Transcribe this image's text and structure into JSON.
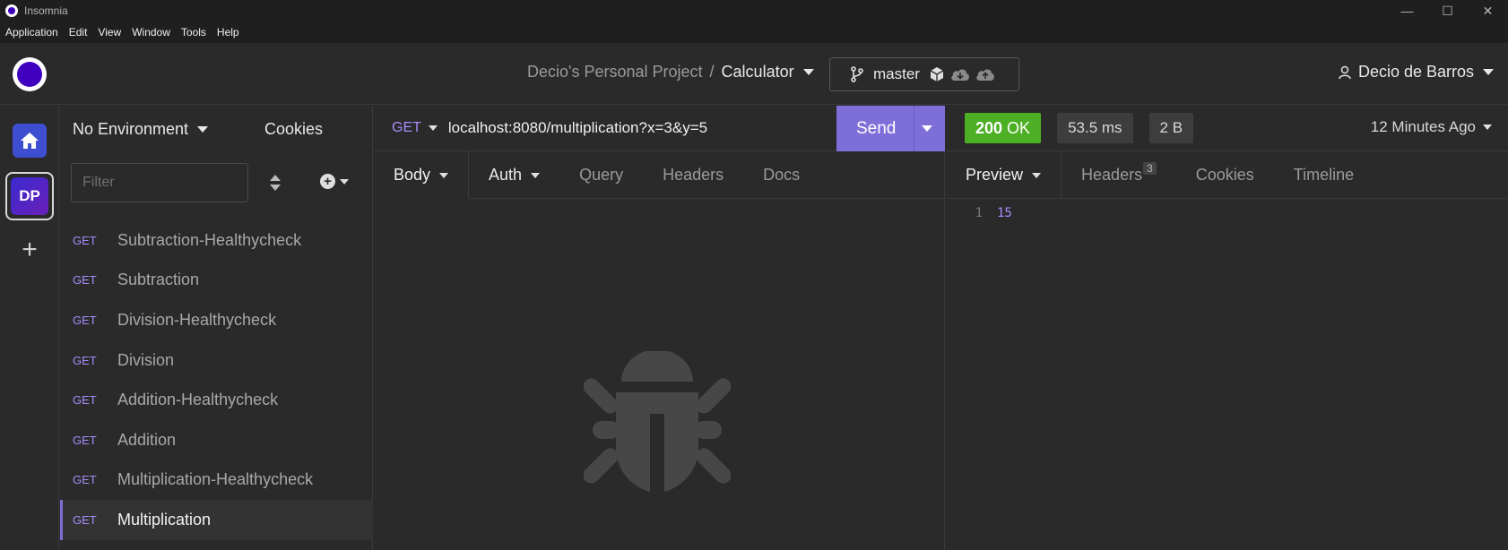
{
  "window": {
    "title": "Insomnia",
    "controls": {
      "minimize": "—",
      "maximize": "☐",
      "close": "✕"
    }
  },
  "menu": [
    "Application",
    "Edit",
    "View",
    "Window",
    "Tools",
    "Help"
  ],
  "header": {
    "project": "Decio's Personal Project",
    "separator": "/",
    "collection": "Calculator",
    "branch": "master",
    "user": "Decio de Barros"
  },
  "rail": {
    "workspace_initials": "DP",
    "add_label": "+"
  },
  "sidebar": {
    "environment": "No Environment",
    "cookies": "Cookies",
    "filter_placeholder": "Filter",
    "requests": [
      {
        "method": "GET",
        "name": "Subtraction-Healthycheck",
        "active": false
      },
      {
        "method": "GET",
        "name": "Subtraction",
        "active": false
      },
      {
        "method": "GET",
        "name": "Division-Healthycheck",
        "active": false
      },
      {
        "method": "GET",
        "name": "Division",
        "active": false
      },
      {
        "method": "GET",
        "name": "Addition-Healthycheck",
        "active": false
      },
      {
        "method": "GET",
        "name": "Addition",
        "active": false
      },
      {
        "method": "GET",
        "name": "Multiplication-Healthycheck",
        "active": false
      },
      {
        "method": "GET",
        "name": "Multiplication",
        "active": true
      }
    ]
  },
  "request": {
    "method": "GET",
    "url": "localhost:8080/multiplication?x=3&y=5",
    "send_label": "Send",
    "tabs": {
      "body": "Body",
      "auth": "Auth",
      "query": "Query",
      "headers": "Headers",
      "docs": "Docs"
    }
  },
  "response": {
    "status_code": "200",
    "status_text": "OK",
    "time": "53.5 ms",
    "size": "2 B",
    "time_ago": "12 Minutes Ago",
    "tabs": {
      "preview": "Preview",
      "headers": "Headers",
      "headers_count": "3",
      "cookies": "Cookies",
      "timeline": "Timeline"
    },
    "body_lines": [
      {
        "line": "1",
        "text": "15"
      }
    ]
  },
  "colors": {
    "accent": "#7e6fd8",
    "method_get": "#a78bfa",
    "status_ok": "#4caf24",
    "brand": "#4000bf"
  }
}
